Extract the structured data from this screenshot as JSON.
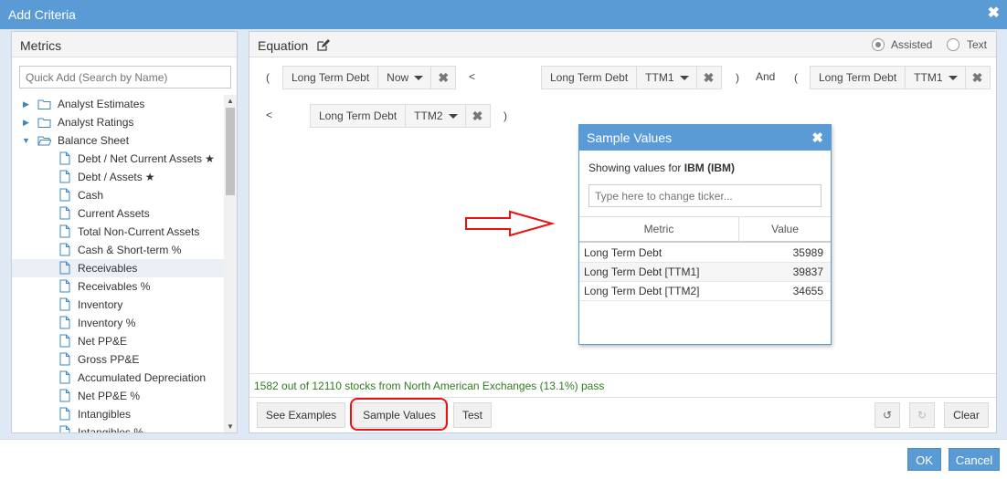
{
  "dialog": {
    "title": "Add Criteria",
    "close": "✖"
  },
  "metrics": {
    "title": "Metrics",
    "search_placeholder": "Quick Add (Search by Name)",
    "tree": [
      {
        "label": "Analyst Estimates",
        "type": "folder",
        "expanded": false
      },
      {
        "label": "Analyst Ratings",
        "type": "folder",
        "expanded": false
      },
      {
        "label": "Balance Sheet",
        "type": "folder",
        "expanded": true
      },
      {
        "label": "Debt / Net Current Assets",
        "type": "doc",
        "star": true
      },
      {
        "label": "Debt / Assets",
        "type": "doc",
        "star": true
      },
      {
        "label": "Cash",
        "type": "doc"
      },
      {
        "label": "Current Assets",
        "type": "doc"
      },
      {
        "label": "Total Non-Current Assets",
        "type": "doc"
      },
      {
        "label": "Cash & Short-term %",
        "type": "doc"
      },
      {
        "label": "Receivables",
        "type": "doc",
        "selected": true
      },
      {
        "label": "Receivables %",
        "type": "doc"
      },
      {
        "label": "Inventory",
        "type": "doc"
      },
      {
        "label": "Inventory %",
        "type": "doc"
      },
      {
        "label": "Net PP&E",
        "type": "doc"
      },
      {
        "label": "Gross PP&E",
        "type": "doc"
      },
      {
        "label": "Accumulated Depreciation",
        "type": "doc"
      },
      {
        "label": "Net PP&E %",
        "type": "doc"
      },
      {
        "label": "Intangibles",
        "type": "doc"
      },
      {
        "label": "Intangibles %",
        "type": "doc"
      }
    ]
  },
  "equation": {
    "title": "Equation",
    "mode_assisted": "Assisted",
    "mode_text": "Text",
    "open_paren": "(",
    "close_paren": ")",
    "lt": "<",
    "and": "And",
    "chips": [
      {
        "metric": "Long Term Debt",
        "period": "Now"
      },
      {
        "metric": "Long Term Debt",
        "period": "TTM1"
      },
      {
        "metric": "Long Term Debt",
        "period": "TTM1"
      },
      {
        "metric": "Long Term Debt",
        "period": "TTM2"
      }
    ],
    "status": "1582 out of 12110 stocks from North American Exchanges (13.1%) pass",
    "buttons": {
      "see_examples": "See Examples",
      "sample_values": "Sample Values",
      "test": "Test",
      "clear": "Clear"
    }
  },
  "sample_values": {
    "title": "Sample Values",
    "showing_prefix": "Showing values for ",
    "ticker": "IBM (IBM)",
    "ticker_placeholder": "Type here to change ticker...",
    "col_metric": "Metric",
    "col_value": "Value",
    "rows": [
      {
        "metric": "Long Term Debt",
        "value": "35989"
      },
      {
        "metric": "Long Term Debt [TTM1]",
        "value": "39837"
      },
      {
        "metric": "Long Term Debt [TTM2]",
        "value": "34655"
      }
    ]
  },
  "footer": {
    "ok": "OK",
    "cancel": "Cancel"
  },
  "colors": {
    "accent": "#5b9bd5",
    "pass_text": "#2e7d1f",
    "highlight": "#e11111"
  }
}
